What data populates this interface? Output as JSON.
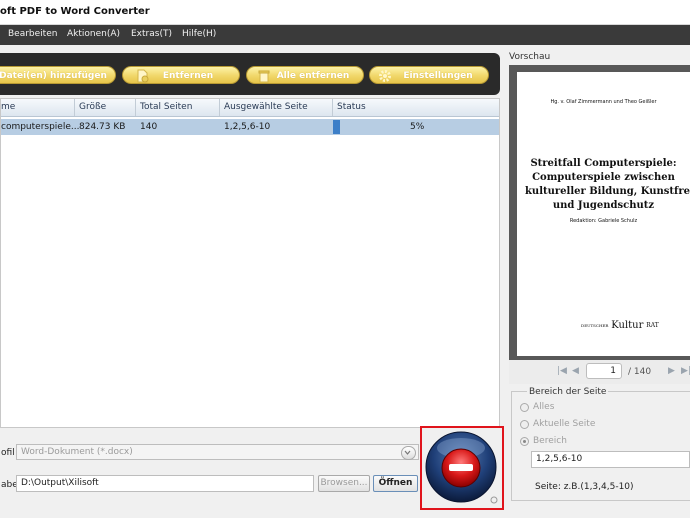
{
  "window": {
    "title": "oft PDF to Word Converter"
  },
  "menu": {
    "items": [
      "Bearbeiten",
      "Aktionen(A)",
      "Extras(T)",
      "Hilfe(H)"
    ]
  },
  "toolbar": {
    "add_label": "Datei(en) hinzufügen",
    "remove_label": "Entfernen",
    "remove_all_label": "Alle entfernen",
    "settings_label": "Einstellungen"
  },
  "table": {
    "columns": [
      "me",
      "Größe",
      "Total Seiten",
      "Ausgewählte Seite",
      "Status"
    ],
    "rows": [
      {
        "name": "computerspiele...",
        "size": "824.73 KB",
        "pages": "140",
        "selected": "1,2,5,6-10",
        "status": "5%",
        "progress": 0.05
      }
    ]
  },
  "output": {
    "profile_label": "ofil",
    "profile_value": "Word-Dokument (*.docx)",
    "dest_label": "abe",
    "dest_value": "D:\\Output\\Xilisoft",
    "browse_label": "Browsen...",
    "open_label": "Öffnen"
  },
  "preview": {
    "label": "Vorschau",
    "page_authors": "Hg. v. Olaf Zimmermann und Theo Geißler",
    "page_title_lines": [
      "Streitfall Computerspiele:",
      "Computerspiele zwischen",
      "kultureller Bildung, Kunstfreihe",
      "und Jugendschutz"
    ],
    "page_editor": "Redaktion: Gabriele Schulz",
    "logo_small": "DEUTSCHER",
    "logo_big": "Kultur",
    "logo_suffix": "RAT",
    "current_page": "1",
    "total_pages": "/ 140"
  },
  "range": {
    "legend": "Bereich der Seite",
    "options": [
      "Alles",
      "Aktuelle Seite",
      "Bereich"
    ],
    "selected_index": 2,
    "value": "1,2,5,6-10",
    "hint": "Seite: z.B.(1,3,4,5-10)"
  },
  "colors": {
    "accent_button": "#f1d76a",
    "stop_frame": "#e0141c",
    "row_selected": "#b7cde3"
  }
}
